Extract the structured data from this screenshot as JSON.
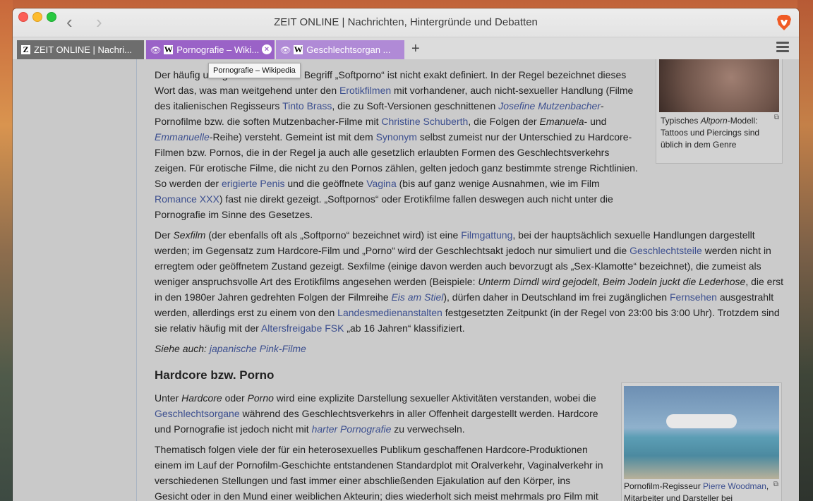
{
  "window": {
    "title": "ZEIT ONLINE | Nachrichten, Hintergründe und Debatten"
  },
  "tabs": [
    {
      "label": "ZEIT ONLINE | Nachri...",
      "favicon": "Z"
    },
    {
      "label": "Pornografie – Wiki...",
      "favicon": "W"
    },
    {
      "label": "Geschlechtsorgan ...",
      "favicon": "W"
    }
  ],
  "tooltip": "Pornografie – Wikipedia",
  "figure1": {
    "caption_pre": "Typisches ",
    "caption_em": "Altporn",
    "caption_post": "-Modell: Tattoos und Piercings sind üblich in dem Genre"
  },
  "figure2": {
    "caption_pre": "Pornofilm-Regisseur ",
    "caption_link": "Pierre Woodman",
    "caption_post": ", Mitarbeiter und Darsteller bei Filmaufnahmen in Australien"
  },
  "p1": {
    "a": "Der häufig und gerne verwendete Begriff „Softporno“ ist nicht exakt definiert. In der Regel bezeichnet dieses Wort das, was man weitgehend unter den ",
    "l1": "Erotikfilmen",
    "b": " mit vorhandener, auch nicht-sexueller Handlung (Filme des italienischen Regisseurs ",
    "l2": "Tinto Brass",
    "c": ", die zu Soft-Versionen geschnittenen ",
    "l3": "Josefine Mutzenbacher",
    "d": "-Pornofilme bzw. die soften Mutzenbacher-Filme mit ",
    "l4": "Christine Schuberth",
    "e": ", die Folgen der ",
    "em1": "Emanuela",
    "f": "- und ",
    "l5": "Emmanuelle",
    "g": "-Reihe) versteht. Gemeint ist mit dem ",
    "l6": "Synonym",
    "h": " selbst zumeist nur der Unterschied zu Hardcore-Filmen bzw. Pornos, die in der Regel ja auch alle gesetzlich erlaubten Formen des Geschlechtsverkehrs zeigen. Für erotische Filme, die nicht zu den Pornos zählen, gelten jedoch ganz bestimmte strenge Richtlinien. So werden der ",
    "l7": "erigierte Penis",
    "i": " und die geöffnete ",
    "l8": "Vagina",
    "j": " (bis auf ganz wenige Ausnahmen, wie im Film ",
    "l9": "Romance XXX",
    "k": ") fast nie direkt gezeigt. „Softpornos“ oder Erotikfilme fallen deswegen auch nicht unter die Pornografie im Sinne des Gesetzes."
  },
  "p2": {
    "a": "Der ",
    "em1": "Sexfilm",
    "b": " (der ebenfalls oft als „Softporno“ bezeichnet wird) ist eine ",
    "l1": "Filmgattung",
    "c": ", bei der hauptsächlich sexuelle Handlungen dargestellt werden; im Gegensatz zum Hardcore-Film und „Porno“ wird der Geschlechtsakt jedoch nur simuliert und die ",
    "l2": "Geschlechtsteile",
    "d": " werden nicht in erregtem oder geöffnetem Zustand gezeigt. Sexfilme (einige davon werden auch bevorzugt als „Sex-Klamotte“ bezeichnet), die zumeist als weniger anspruchsvolle Art des Erotikfilms angesehen werden (Beispiele: ",
    "em2": "Unterm Dirndl wird gejodelt",
    "e": ", ",
    "em3": "Beim Jodeln juckt die Lederhose",
    "f": ", die erst in den 1980er Jahren gedrehten Folgen der Filmreihe ",
    "l3": "Eis am Stiel",
    "g": "), dürfen daher in Deutschland im frei zugänglichen ",
    "l4": "Fernsehen",
    "h": " ausgestrahlt werden, allerdings erst zu einem von den ",
    "l5": "Landesmedienanstalten",
    "i": " festgesetzten Zeitpunkt (in der Regel von 23:00 bis 3:00 Uhr). Trotzdem sind sie relativ häufig mit der ",
    "l6": "Altersfreigabe FSK",
    "j": " „ab 16 Jahren“ klassifiziert."
  },
  "seealso": {
    "pre": "Siehe auch: ",
    "link": "japanische Pink-Filme"
  },
  "heading": "Hardcore bzw. Porno",
  "p3": {
    "a": "Unter ",
    "em1": "Hardcore",
    "b": " oder ",
    "em2": "Porno",
    "c": " wird eine explizite Darstellung sexueller Aktivitäten verstanden, wobei die ",
    "l1": "Geschlechtsorgane",
    "d": " während des Geschlechtsverkehrs in aller Offenheit dargestellt werden. Hardcore und Pornografie ist jedoch nicht mit ",
    "l2": "harter Pornografie",
    "e": " zu verwechseln."
  },
  "p4": "Thematisch folgen viele der für ein heterosexuelles Publikum geschaffenen Hardcore-Produktionen einem im Lauf der Pornofilm-Geschichte entstandenen Standardplot mit Oralverkehr, Vaginalverkehr in verschiedenen Stellungen und fast immer einer abschließenden Ejakulation auf den Körper, ins Gesicht oder in den Mund einer weiblichen Akteurin; dies wiederholt sich meist mehrmals pro Film mit jeweils verschiedenen Darstellern. Dazu kommen als Varianten häufig Analverkehr und lesbisch-"
}
